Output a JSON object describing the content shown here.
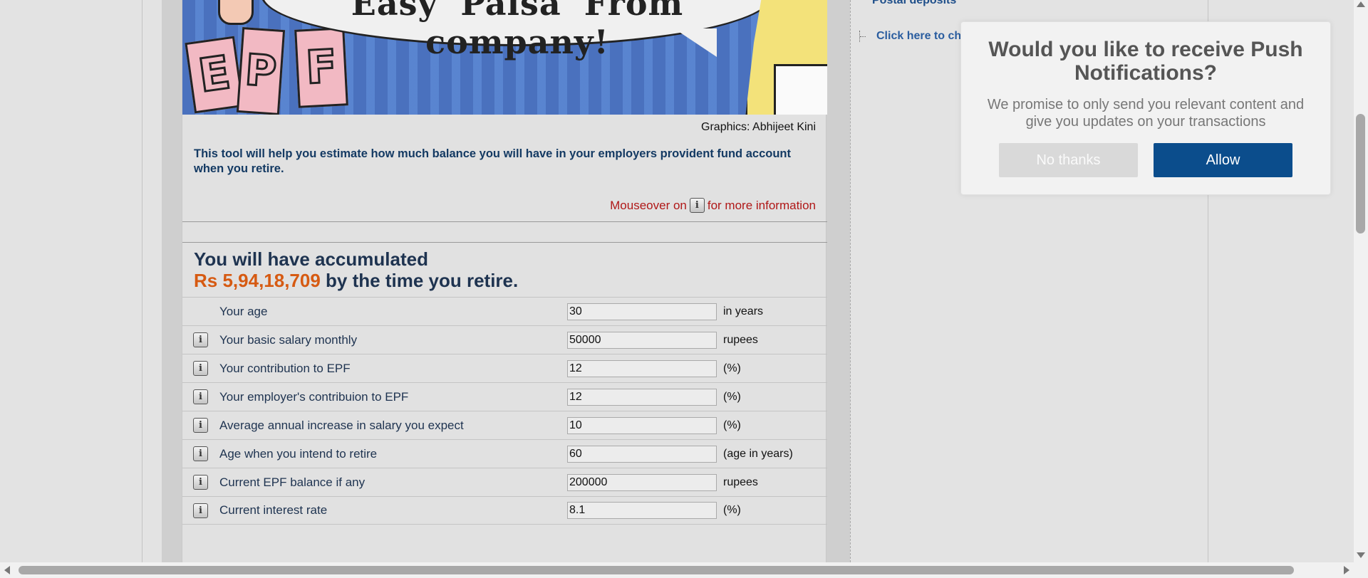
{
  "banner": {
    "speech_text": "Easy 'Paisa' From company!",
    "cards": [
      "E",
      "P",
      "F"
    ]
  },
  "credit": "Graphics: Abhijeet Kini",
  "intro": "This tool will help you estimate how much balance you will have in your employers provident fund account when you retire.",
  "mouseover": {
    "before": "Mouseover on",
    "after": "for more information",
    "icon": "info-icon"
  },
  "result": {
    "line1": "You will have accumulated",
    "amount": "Rs 5,94,18,709",
    "line2_suffix": " by the time you retire."
  },
  "rows": [
    {
      "label": "Your age",
      "value": "30",
      "unit": "in years",
      "has_info": false
    },
    {
      "label": "Your basic salary monthly",
      "value": "50000",
      "unit": "rupees",
      "has_info": true
    },
    {
      "label": "Your contribution to EPF",
      "value": "12",
      "unit": "(%)",
      "has_info": true
    },
    {
      "label": "Your employer's contribuion to EPF",
      "value": "12",
      "unit": "(%)",
      "has_info": true
    },
    {
      "label": "Average annual increase in salary you expect",
      "value": "10",
      "unit": "(%)",
      "has_info": true
    },
    {
      "label": "Age when you intend to retire",
      "value": "60",
      "unit": "(age in years)",
      "has_info": true
    },
    {
      "label": "Current EPF balance if any",
      "value": "200000",
      "unit": "rupees",
      "has_info": true
    },
    {
      "label": "Current interest rate",
      "value": "8.1",
      "unit": "(%)",
      "has_info": true
    }
  ],
  "sidebar": {
    "heading": "Postal deposits",
    "link": "Click here to che"
  },
  "popup": {
    "title": "Would you like to receive Push Notifications?",
    "message": "We promise to only send you relevant content and give you updates on your transactions",
    "no_label": "No thanks",
    "allow_label": "Allow"
  },
  "colors": {
    "amount": "#d65a12",
    "label": "#1e3350",
    "intro": "#143a63",
    "mouseover": "#b01818",
    "allow_button": "#0b4d8c"
  }
}
